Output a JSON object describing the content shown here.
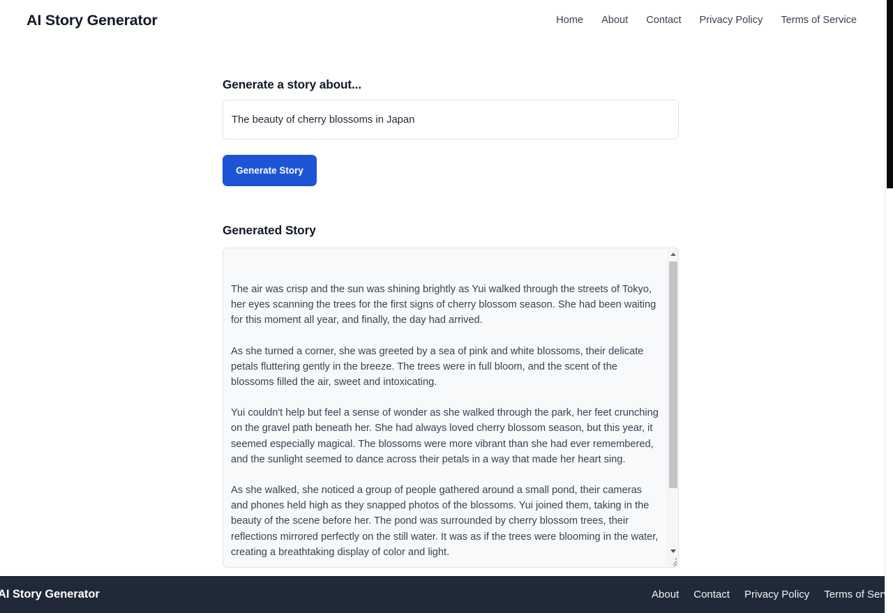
{
  "header": {
    "brand": "AI Story Generator",
    "nav": [
      {
        "label": "Home"
      },
      {
        "label": "About"
      },
      {
        "label": "Contact"
      },
      {
        "label": "Privacy Policy"
      },
      {
        "label": "Terms of Service"
      }
    ]
  },
  "form": {
    "label": "Generate a story about...",
    "input_value": "The beauty of cherry blossoms in Japan",
    "input_placeholder": "",
    "submit_label": "Generate Story",
    "submit_color": "#1d54d6"
  },
  "story": {
    "title": "Generated Story",
    "paragraphs": [
      "The air was crisp and the sun was shining brightly as Yui walked through the streets of Tokyo, her eyes scanning the trees for the first signs of cherry blossom season. She had been waiting for this moment all year, and finally, the day had arrived.",
      "As she turned a corner, she was greeted by a sea of pink and white blossoms, their delicate petals fluttering gently in the breeze. The trees were in full bloom, and the scent of the blossoms filled the air, sweet and intoxicating.",
      "Yui couldn't help but feel a sense of wonder as she walked through the park, her feet crunching on the gravel path beneath her. She had always loved cherry blossom season, but this year, it seemed especially magical. The blossoms were more vibrant than she had ever remembered, and the sunlight seemed to dance across their petals in a way that made her heart sing.",
      "As she walked, she noticed a group of people gathered around a small pond, their cameras and phones held high as they snapped photos of the blossoms. Yui joined them, taking in the beauty of the scene before her. The pond was surrounded by cherry blossom trees, their reflections mirrored perfectly on the still water. It was as if the trees were blooming in the water, creating a breathtaking display of color and light."
    ],
    "background": "#f8f9fb"
  },
  "footer": {
    "brand": "AI Story Generator",
    "background": "#1f2937",
    "nav": [
      {
        "label": "About"
      },
      {
        "label": "Contact"
      },
      {
        "label": "Privacy Policy"
      },
      {
        "label": "Terms of Service"
      }
    ]
  }
}
